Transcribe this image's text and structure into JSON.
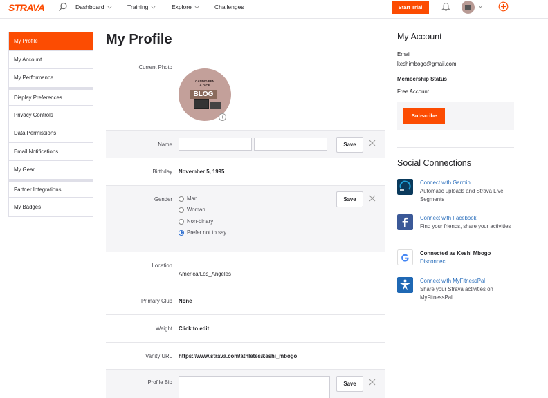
{
  "nav": {
    "logo": "STRAVA",
    "items": [
      "Dashboard",
      "Training",
      "Explore",
      "Challenges"
    ],
    "start_trial": "Start Trial"
  },
  "sidebar": {
    "items": [
      {
        "label": "My Profile"
      },
      {
        "label": "My Account"
      },
      {
        "label": "My Performance"
      },
      {
        "label": "Display Preferences"
      },
      {
        "label": "Privacy Controls"
      },
      {
        "label": "Data Permissions"
      },
      {
        "label": "Email Notifications"
      },
      {
        "label": "My Gear"
      },
      {
        "label": "Partner Integrations"
      },
      {
        "label": "My Badges"
      }
    ]
  },
  "profile": {
    "title": "My Profile",
    "photo_label": "Current Photo",
    "photo_text_top": "CANDID PEN",
    "photo_text_mid": "& DICE",
    "photo_text_blog": "BLOG",
    "name_label": "Name",
    "birthday_label": "Birthday",
    "birthday_value": "November 5, 1995",
    "gender_label": "Gender",
    "gender_options": [
      "Man",
      "Woman",
      "Non-binary",
      "Prefer not to say"
    ],
    "location_label": "Location",
    "location_value": "America/Los_Angeles",
    "club_label": "Primary Club",
    "club_value": "None",
    "weight_label": "Weight",
    "weight_value": "Click to edit",
    "vanity_label": "Vanity URL",
    "vanity_value": "https://www.strava.com/athletes/keshi_mbogo",
    "bio_label": "Profile Bio",
    "save_label": "Save"
  },
  "account": {
    "title": "My Account",
    "email_label": "Email",
    "email_value": "keshimbogo@gmail.com",
    "membership_label": "Membership Status",
    "membership_value": "Free Account",
    "subscribe_label": "Subscribe"
  },
  "social": {
    "title": "Social Connections",
    "garmin_link": "Connect with Garmin",
    "garmin_desc": "Automatic uploads and Strava Live Segments",
    "facebook_link": "Connect with Facebook",
    "facebook_desc": "Find your friends, share your activities",
    "google_status": "Connected as Keshi Mbogo",
    "google_link": "Disconnect",
    "mfp_link": "Connect with MyFitnessPal",
    "mfp_desc": "Share your Strava activities on MyFitnessPal"
  },
  "colors": {
    "brand": "#fc4c02",
    "link": "#2a6ebb",
    "garmin": "#0a3a5c",
    "facebook": "#3b5998",
    "mfp": "#1f68b4"
  }
}
